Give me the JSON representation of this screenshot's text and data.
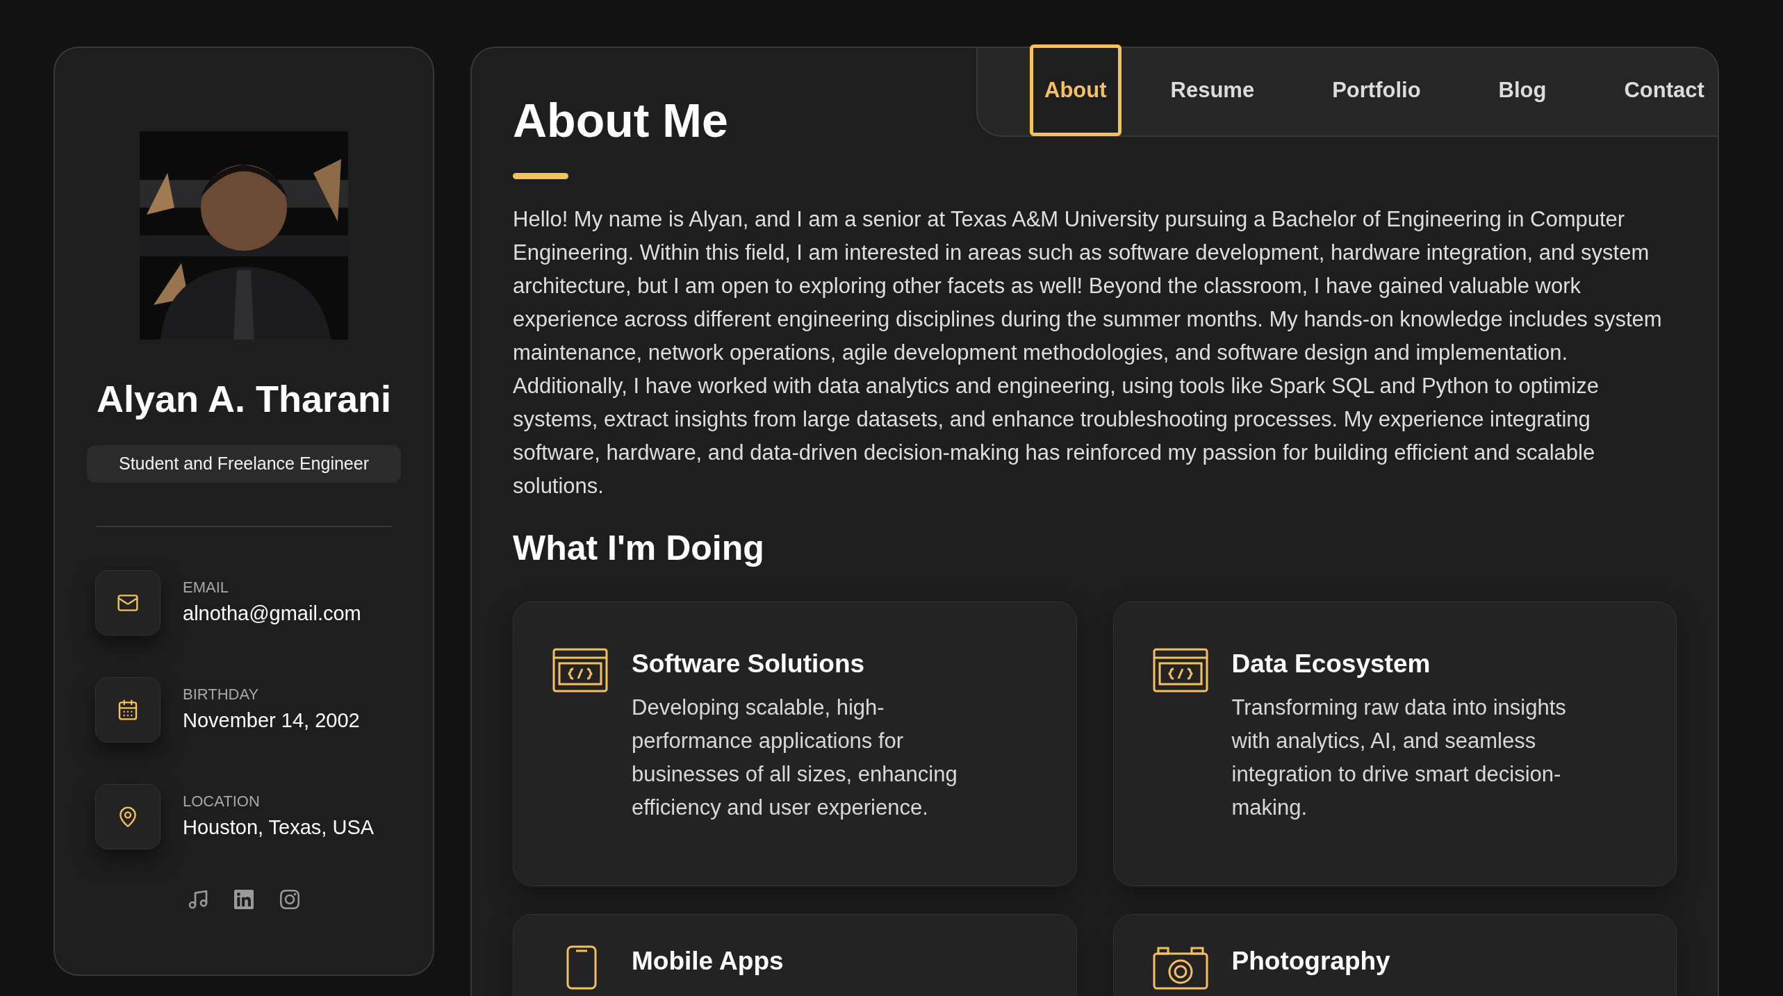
{
  "sidebar": {
    "name": "Alyan A. Tharani",
    "title": "Student and Freelance Engineer",
    "contacts": [
      {
        "kind": "email",
        "label": "EMAIL",
        "value": "alnotha@gmail.com"
      },
      {
        "kind": "birthday",
        "label": "BIRTHDAY",
        "value": "November 14, 2002"
      },
      {
        "kind": "location",
        "label": "LOCATION",
        "value": "Houston, Texas, USA"
      }
    ],
    "socials": [
      {
        "kind": "music"
      },
      {
        "kind": "linkedin"
      },
      {
        "kind": "instagram"
      }
    ]
  },
  "nav": [
    {
      "label": "About",
      "selected": true
    },
    {
      "label": "Resume",
      "selected": false
    },
    {
      "label": "Portfolio",
      "selected": false
    },
    {
      "label": "Blog",
      "selected": false
    },
    {
      "label": "Contact",
      "selected": false
    }
  ],
  "heading": "About Me",
  "paragraph": "Hello! My name is Alyan, and I am a senior at Texas A&M University pursuing a Bachelor of Engineering in Computer Engineering. Within this field, I am interested in areas such as software development, hardware integration, and system architecture, but I am open to exploring other facets as well! Beyond the classroom, I have gained valuable work experience across different engineering disciplines during the summer months. My hands-on knowledge includes system maintenance, network operations, agile development methodologies, and software design and implementation. Additionally, I have worked with data analytics and engineering, using tools like Spark SQL and Python to optimize systems, extract insights from large datasets, and enhance troubleshooting processes. My experience integrating software, hardware, and data-driven decision-making has reinforced my passion for building efficient and scalable solutions.",
  "services_heading": "What I'm Doing",
  "services": [
    {
      "kind": "code",
      "title": "Software Solutions",
      "text": "Developing scalable, high-performance applications for businesses of all sizes, enhancing efficiency and user experience."
    },
    {
      "kind": "code",
      "title": "Data Ecosystem",
      "text": "Transforming raw data into insights with analytics, AI, and seamless integration to drive smart decision-making."
    },
    {
      "kind": "mobile",
      "title": "Mobile Apps"
    },
    {
      "kind": "camera",
      "title": "Photography"
    }
  ]
}
